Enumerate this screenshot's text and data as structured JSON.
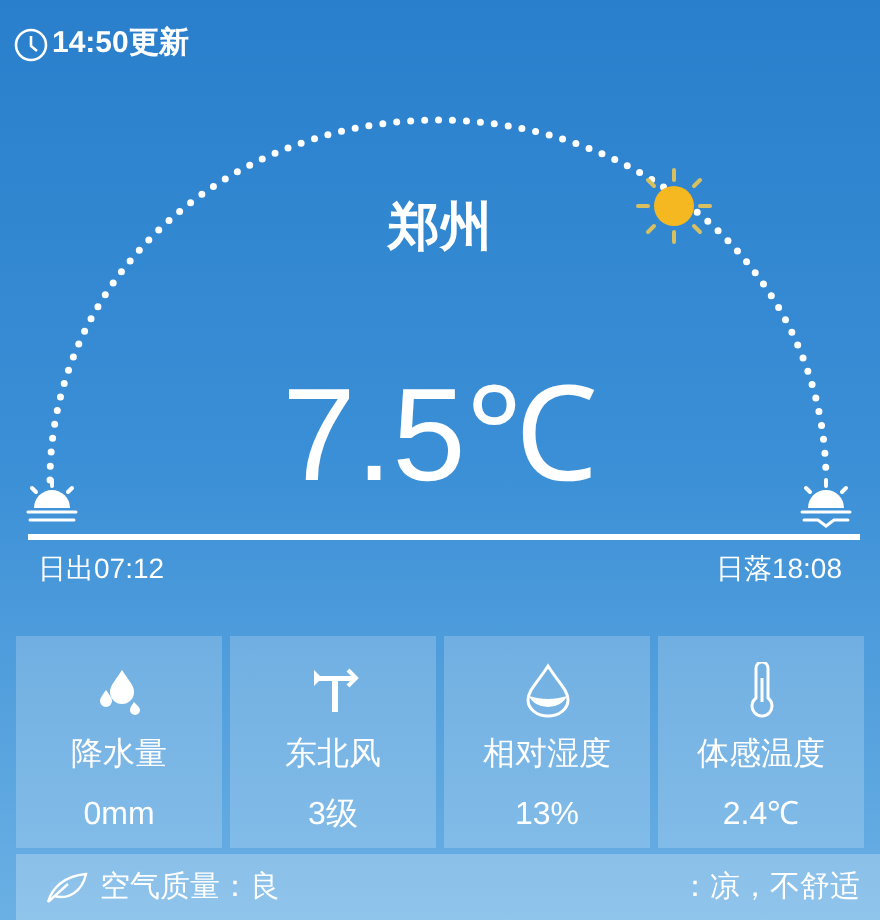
{
  "header": {
    "update_time": "14:50更新"
  },
  "city": "郑州",
  "temperature": "7.5℃",
  "sunrise": "日出07:12",
  "sunset": "日落18:08",
  "cards": [
    {
      "kind": "rain",
      "label": "降水量",
      "value": "0mm"
    },
    {
      "kind": "wind",
      "label": "东北风",
      "value": "3级"
    },
    {
      "kind": "humidity",
      "label": "相对湿度",
      "value": "13%"
    },
    {
      "kind": "feels",
      "label": "体感温度",
      "value": "2.4℃"
    }
  ],
  "air_bar": {
    "air_quality": "空气质量：良",
    "comfort": "：凉，不舒适"
  }
}
